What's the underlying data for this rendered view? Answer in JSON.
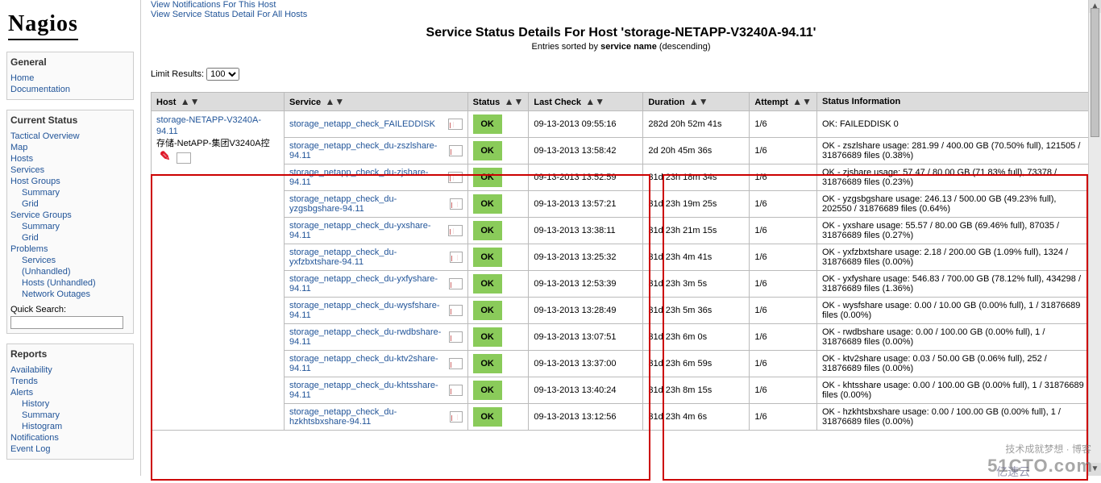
{
  "logo_text": "Nagios",
  "top_links": {
    "a": "View Notifications For This Host",
    "b": "View Service Status Detail For All Hosts"
  },
  "page_title": "Service Status Details For Host 'storage-NETAPP-V3240A-94.11'",
  "page_sub_prefix": "Entries sorted by ",
  "page_sub_bold": "service name",
  "page_sub_suffix": " (descending)",
  "limit_label": "Limit Results:",
  "limit_value": "100",
  "quick_search_label": "Quick Search:",
  "sidebar": {
    "general": {
      "title": "General",
      "items": [
        "Home",
        "Documentation"
      ]
    },
    "current": {
      "title": "Current Status",
      "items": [
        {
          "label": "Tactical Overview",
          "indent": 0
        },
        {
          "label": "Map",
          "indent": 0
        },
        {
          "label": "Hosts",
          "indent": 0
        },
        {
          "label": "Services",
          "indent": 0
        },
        {
          "label": "Host Groups",
          "indent": 0
        },
        {
          "label": "Summary",
          "indent": 1
        },
        {
          "label": "Grid",
          "indent": 1
        },
        {
          "label": "Service Groups",
          "indent": 0
        },
        {
          "label": "Summary",
          "indent": 1
        },
        {
          "label": "Grid",
          "indent": 1
        },
        {
          "label": "Problems",
          "indent": 0
        },
        {
          "label": "Services",
          "indent": 1
        },
        {
          "label": "(Unhandled)",
          "indent": 1
        },
        {
          "label": "Hosts (Unhandled)",
          "indent": 1
        },
        {
          "label": "Network Outages",
          "indent": 1
        }
      ]
    },
    "reports": {
      "title": "Reports",
      "items": [
        "Availability",
        "Trends",
        "Alerts",
        "History",
        "Summary",
        "Histogram",
        "Notifications",
        "Event Log"
      ]
    }
  },
  "headers": {
    "host": "Host",
    "service": "Service",
    "status": "Status",
    "lastcheck": "Last Check",
    "duration": "Duration",
    "attempt": "Attempt",
    "info": "Status Information"
  },
  "host_block": {
    "line1": "storage-NETAPP-V3240A-94.11",
    "line2": "存储-NetAPP-集团V3240A控"
  },
  "rows": [
    {
      "svc": "storage_netapp_check_FAILEDDISK",
      "status": "OK",
      "last": "09-13-2013 09:55:16",
      "dur": "282d 20h 52m 41s",
      "att": "1/6",
      "info": "OK: FAILEDDISK 0"
    },
    {
      "svc": "storage_netapp_check_du-zszlshare-94.11",
      "status": "OK",
      "last": "09-13-2013 13:58:42",
      "dur": "2d 20h 45m 36s",
      "att": "1/6",
      "info": "OK - zszlshare usage: 281.99 / 400.00 GB (70.50% full), 121505 / 31876689 files (0.38%)"
    },
    {
      "svc": "storage_netapp_check_du-zjshare-94.11",
      "status": "OK",
      "last": "09-13-2013 13:52:59",
      "dur": "31d 23h 18m 34s",
      "att": "1/6",
      "info": "OK - zjshare usage: 57.47 / 80.00 GB (71.83% full), 73378 / 31876689 files (0.23%)"
    },
    {
      "svc": "storage_netapp_check_du-yzgsbgshare-94.11",
      "status": "OK",
      "last": "09-13-2013 13:57:21",
      "dur": "31d 23h 19m 25s",
      "att": "1/6",
      "info": "OK - yzgsbgshare usage: 246.13 / 500.00 GB (49.23% full), 202550 / 31876689 files (0.64%)"
    },
    {
      "svc": "storage_netapp_check_du-yxshare-94.11",
      "status": "OK",
      "last": "09-13-2013 13:38:11",
      "dur": "31d 23h 21m 15s",
      "att": "1/6",
      "info": "OK - yxshare usage: 55.57 / 80.00 GB (69.46% full), 87035 / 31876689 files (0.27%)"
    },
    {
      "svc": "storage_netapp_check_du-yxfzbxtshare-94.11",
      "status": "OK",
      "last": "09-13-2013 13:25:32",
      "dur": "31d 23h 4m 41s",
      "att": "1/6",
      "info": "OK - yxfzbxtshare usage: 2.18 / 200.00 GB (1.09% full), 1324 / 31876689 files (0.00%)"
    },
    {
      "svc": "storage_netapp_check_du-yxfyshare-94.11",
      "status": "OK",
      "last": "09-13-2013 12:53:39",
      "dur": "31d 23h 3m 5s",
      "att": "1/6",
      "info": "OK - yxfyshare usage: 546.83 / 700.00 GB (78.12% full), 434298 / 31876689 files (1.36%)"
    },
    {
      "svc": "storage_netapp_check_du-wysfshare-94.11",
      "status": "OK",
      "last": "09-13-2013 13:28:49",
      "dur": "31d 23h 5m 36s",
      "att": "1/6",
      "info": "OK - wysfshare usage: 0.00 / 10.00 GB (0.00% full), 1 / 31876689 files (0.00%)"
    },
    {
      "svc": "storage_netapp_check_du-rwdbshare-94.11",
      "status": "OK",
      "last": "09-13-2013 13:07:51",
      "dur": "31d 23h 6m 0s",
      "att": "1/6",
      "info": "OK - rwdbshare usage: 0.00 / 100.00 GB (0.00% full), 1 / 31876689 files (0.00%)"
    },
    {
      "svc": "storage_netapp_check_du-ktv2share-94.11",
      "status": "OK",
      "last": "09-13-2013 13:37:00",
      "dur": "31d 23h 6m 59s",
      "att": "1/6",
      "info": "OK - ktv2share usage: 0.03 / 50.00 GB (0.06% full), 252 / 31876689 files (0.00%)"
    },
    {
      "svc": "storage_netapp_check_du-khtsshare-94.11",
      "status": "OK",
      "last": "09-13-2013 13:40:24",
      "dur": "31d 23h 8m 15s",
      "att": "1/6",
      "info": "OK - khtsshare usage: 0.00 / 100.00 GB (0.00% full), 1 / 31876689 files (0.00%)"
    },
    {
      "svc": "storage_netapp_check_du-hzkhtsbxshare-94.11",
      "status": "OK",
      "last": "09-13-2013 13:12:56",
      "dur": "31d 23h 4m 6s",
      "att": "1/6",
      "info": "OK - hzkhtsbxshare usage: 0.00 / 100.00 GB (0.00% full), 1 / 31876689 files (0.00%)"
    }
  ],
  "watermarks": {
    "a": "51CTO.com",
    "b": "技术成就梦想 · 博客",
    "c": "亿速云"
  }
}
